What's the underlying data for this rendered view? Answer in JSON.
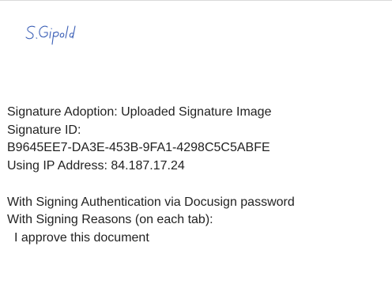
{
  "signature": {
    "text": "S.Gipold",
    "ink_color": "#3b5fb6"
  },
  "details": {
    "adoption": "Signature Adoption: Uploaded Signature Image",
    "id_label": "Signature ID:",
    "id_value": "B9645EE7-DA3E-453B-9FA1-4298C5C5ABFE",
    "ip": "Using IP Address: 84.187.17.24",
    "auth": "With Signing Authentication via Docusign password",
    "reasons_label": "With Signing Reasons (on each tab):",
    "reason_1": "I approve this document"
  },
  "colors": {
    "text": "#222222",
    "rule": "#d9d9d9"
  }
}
